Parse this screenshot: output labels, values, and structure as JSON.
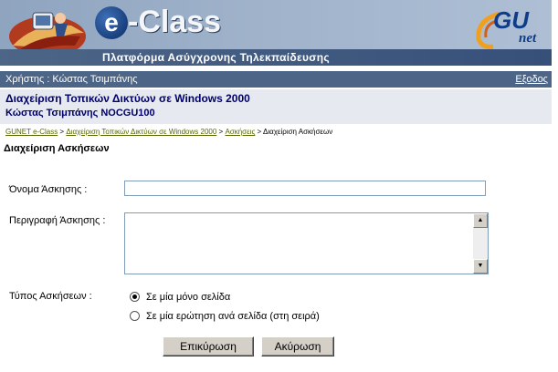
{
  "header": {
    "logo_text_e": "e",
    "logo_text_rest": "-Class",
    "platform_title": "Πλατφόρμα Ασύγχρονης Τηλεκπαίδευσης",
    "partner_logo_main": "GU",
    "partner_logo_sub": "net"
  },
  "userbar": {
    "user_label": "Χρήστης : Κώστας Τσιμπάνης",
    "logout_label": "Εξοδος"
  },
  "course": {
    "title": "Διαχείριση Τοπικών Δικτύων σε Windows 2000",
    "info": "Κώστας Τσιμπάνης NOCGU100"
  },
  "breadcrumb": {
    "items": [
      "GUNET e-Class",
      "Διαχείριση Τοπικών Δικτύων σε Windows 2000",
      "Ασκήσεις"
    ],
    "separator": " > ",
    "current": "Διαχείριση Ασκήσεων"
  },
  "page": {
    "title": "Διαχείριση Ασκήσεων"
  },
  "form": {
    "name_label": "Όνομα Άσκησης :",
    "name_value": "",
    "description_label": "Περιγραφή Άσκησης :",
    "description_value": "",
    "type_label": "Τύπος Ασκήσεων :",
    "type_options": [
      "Σε μία μόνο σελίδα",
      "Σε μία ερώτηση ανά σελίδα (στη σειρά)"
    ],
    "type_selected": 0,
    "submit_label": "Επικύρωση",
    "cancel_label": "Ακύρωση"
  },
  "colors": {
    "accent_bar": "#4d6586",
    "course_box": "#e6e9f0",
    "course_text": "#000066",
    "link": "#556600"
  }
}
